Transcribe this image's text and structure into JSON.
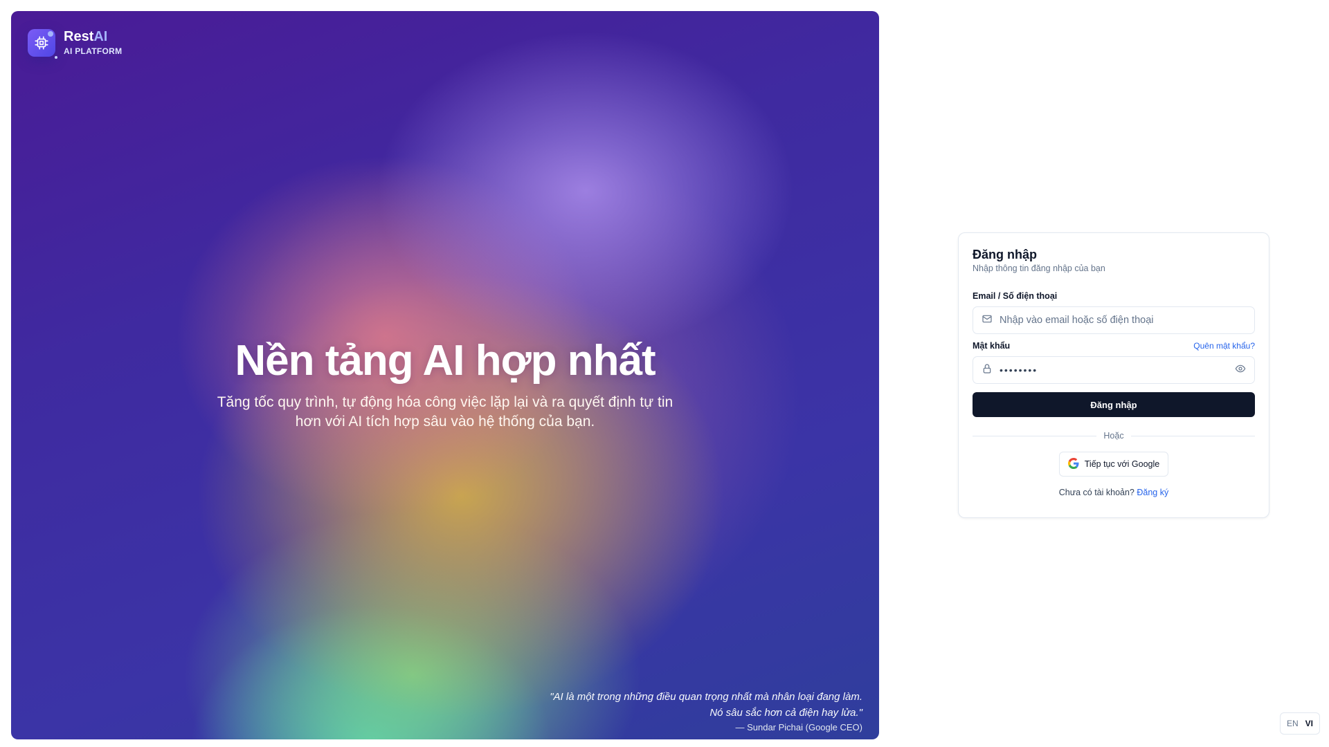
{
  "brand": {
    "name_main": "Rest",
    "name_accent": "AI",
    "subtitle": "AI PLATFORM"
  },
  "hero": {
    "title": "Nền tảng AI hợp nhất",
    "description_line1": "Tăng tốc quy trình, tự động hóa công việc lặp lại và ra quyết định tự tin",
    "description_line2": "hơn với AI tích hợp sâu vào hệ thống của bạn.",
    "quote_line1": "\"AI là một trong những điều quan trọng nhất mà nhân loại đang làm.",
    "quote_line2": "Nó sâu sắc hơn cả điện hay lửa.\"",
    "quote_author": "— Sundar Pichai (Google CEO)"
  },
  "login": {
    "title": "Đăng nhập",
    "subtitle": "Nhập thông tin đăng nhập của bạn",
    "email_label": "Email / Số điện thoại",
    "email_placeholder": "Nhập vào email hoặc số điện thoại",
    "password_label": "Mật khẩu",
    "forgot_password": "Quên mật khẩu?",
    "password_mask": "••••••••",
    "submit_label": "Đăng nhập",
    "divider_text": "Hoặc",
    "google_label": "Tiếp tục với Google",
    "no_account_text": "Chưa có tài khoản?",
    "signup_link": "Đăng ký"
  },
  "language": {
    "options": [
      "EN",
      "VI"
    ],
    "selected": "VI"
  },
  "icons": {
    "logo": "chip-icon",
    "email": "mail-icon",
    "password": "lock-icon",
    "toggle_password": "eye-icon",
    "google": "google-icon"
  },
  "colors": {
    "primary_button": "#0f172a",
    "link": "#2563eb",
    "brand_accent": "#a5b4fc"
  }
}
